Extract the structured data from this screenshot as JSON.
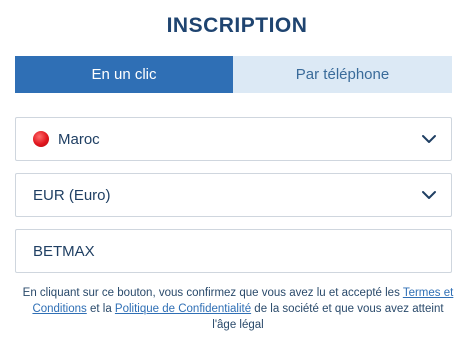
{
  "header": {
    "title": "INSCRIPTION"
  },
  "tabs": [
    {
      "label": "En un clic",
      "active": true
    },
    {
      "label": "Par téléphone",
      "active": false
    }
  ],
  "country_select": {
    "value": "Maroc",
    "flag_icon": "morocco-flag-icon"
  },
  "currency_select": {
    "value": "EUR (Euro)"
  },
  "promo_input": {
    "value": "BETMAX"
  },
  "legal": {
    "text_before": "En cliquant sur ce bouton, vous confirmez que vous avez lu et accepté les ",
    "terms_link": "Termes et Conditions",
    "text_middle": " et la ",
    "privacy_link": "Politique de Confidentialité",
    "text_after": " de la société et que vous avez atteint l'âge légal"
  },
  "colors": {
    "accent": "#2f6fb5",
    "tab_inactive_bg": "#dce9f5",
    "title": "#1f4470",
    "border": "#cfd6de"
  }
}
